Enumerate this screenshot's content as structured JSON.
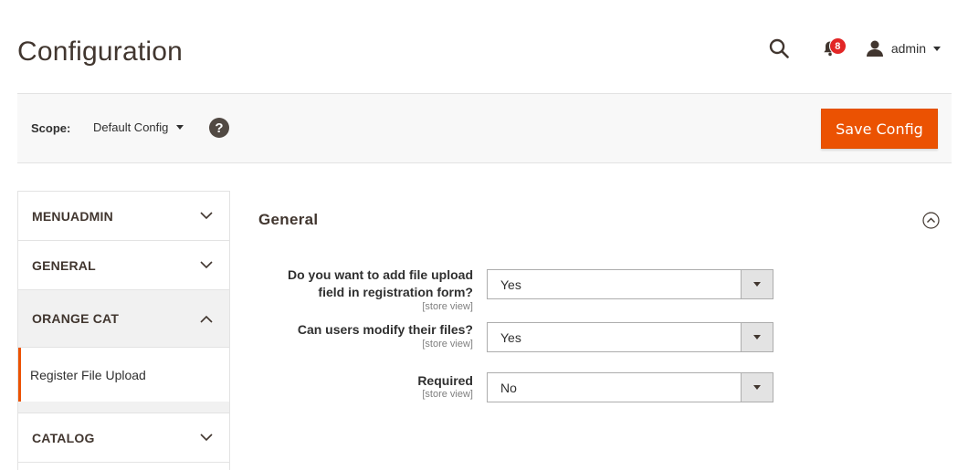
{
  "page": {
    "title": "Configuration"
  },
  "header": {
    "notification_count": "8",
    "user_name": "admin"
  },
  "scope": {
    "label": "Scope:",
    "value": "Default Config",
    "help_glyph": "?"
  },
  "actions": {
    "save_label": "Save Config"
  },
  "sidebar": {
    "tabs": [
      {
        "label": "MENUADMIN",
        "state": "collapsed"
      },
      {
        "label": "GENERAL",
        "state": "collapsed"
      },
      {
        "label": "ORANGE CAT",
        "state": "expanded"
      },
      {
        "label": "CATALOG",
        "state": "collapsed"
      }
    ],
    "active_item": "Register File Upload"
  },
  "section": {
    "title": "General",
    "fields": [
      {
        "label_line1": "Do you want to add file upload",
        "label_line2": "field in registration form?",
        "scope": "[store view]",
        "value": "Yes"
      },
      {
        "label_line1": "Can users modify their files?",
        "scope": "[store view]",
        "value": "Yes"
      },
      {
        "label_line1": "Required",
        "scope": "[store view]",
        "value": "No"
      }
    ]
  },
  "colors": {
    "accent": "#eb5202",
    "badge": "#e22626",
    "panel": "#f8f8f8"
  },
  "icons": [
    "search-icon",
    "bell-icon",
    "user-icon",
    "help-icon",
    "chevron-down-icon",
    "chevron-up-icon",
    "collapse-circle-icon"
  ]
}
